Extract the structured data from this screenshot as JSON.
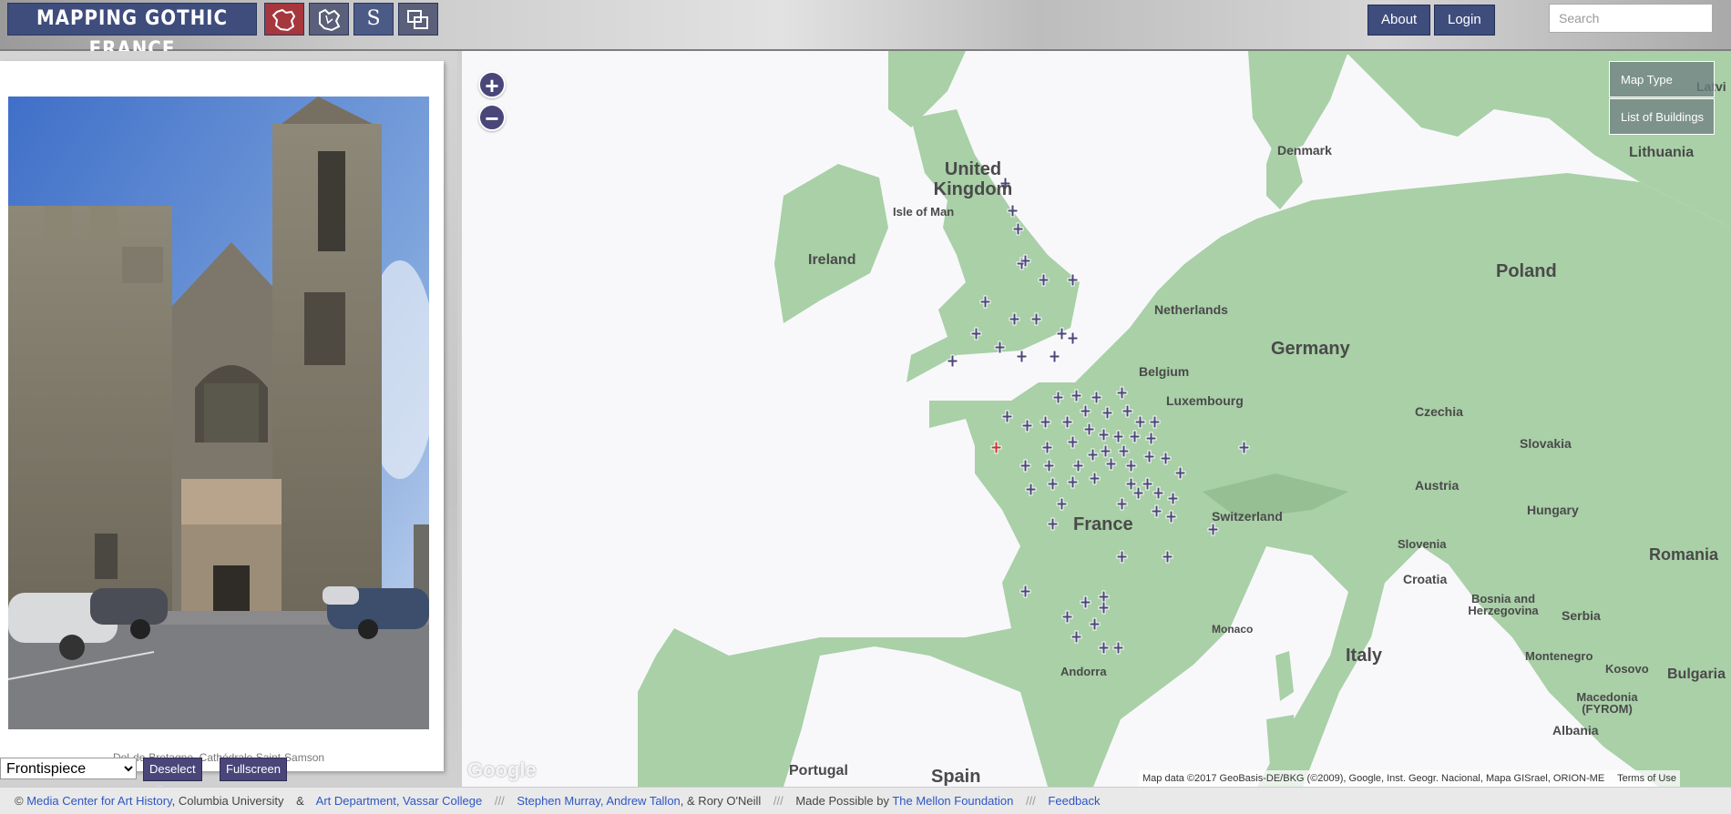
{
  "header": {
    "logo": "MAPPING GOTHIC FRANCE",
    "nav_s_label": "S",
    "about": "About",
    "login": "Login",
    "search_placeholder": "Search"
  },
  "left": {
    "caption": "Dol-de-Bretagne, Cathédrale Saint-Samson",
    "select_value": "Frontispiece",
    "deselect_all": "Deselect All",
    "fullscreen": "Fullscreen"
  },
  "map": {
    "zoom_in": "+",
    "zoom_out": "−",
    "map_type": "Map Type",
    "list_of_buildings": "List of Buildings",
    "attribution": "Map data ©2017 GeoBasis-DE/BKG (©2009), Google, Inst. Geogr. Nacional, Mapa GISrael, ORION-ME",
    "terms": "Terms of Use",
    "google": "Google",
    "labels": {
      "uk": [
        "United",
        "Kingdom"
      ],
      "isle_of_man": "Isle of Man",
      "ireland": "Ireland",
      "denmark": "Denmark",
      "lithuania": "Lithuania",
      "latvia": "Latvi",
      "netherlands": "Netherlands",
      "germany": "Germany",
      "poland": "Poland",
      "belgium": "Belgium",
      "luxembourg": "Luxembourg",
      "czechia": "Czechia",
      "slovakia": "Slovakia",
      "france": "France",
      "switzerland": "Switzerland",
      "austria": "Austria",
      "hungary": "Hungary",
      "slovenia": "Slovenia",
      "romania": "Romania",
      "croatia": "Croatia",
      "bosnia": [
        "Bosnia and",
        "Herzegovina"
      ],
      "serbia": "Serbia",
      "monaco": "Monaco",
      "andorra": "Andorra",
      "italy": "Italy",
      "montenegro": "Montenegro",
      "kosovo": "Kosovo",
      "bulgaria": "Bulgaria",
      "macedonia": [
        "Macedonia",
        "(FYROM)"
      ],
      "albania": "Albania",
      "portugal": "Portugal",
      "spain": "Spain"
    }
  },
  "footer": {
    "copy": "©",
    "mcah": "Media Center for Art History",
    "columbia": ", Columbia University",
    "amp": "&",
    "art_dept": "Art Department, Vassar College",
    "sep": "///",
    "people": "Stephen Murray, Andrew Tallon",
    "people2": ", & Rory O'Neill",
    "made_possible": "Made Possible by ",
    "mellon": "The Mellon Foundation",
    "feedback": "Feedback"
  },
  "colors": {
    "accent": "#3f4d7d",
    "marker": "#4a4679",
    "selected_marker": "#c0392b",
    "land": "#a9d0a7",
    "link": "#2d56c4"
  }
}
